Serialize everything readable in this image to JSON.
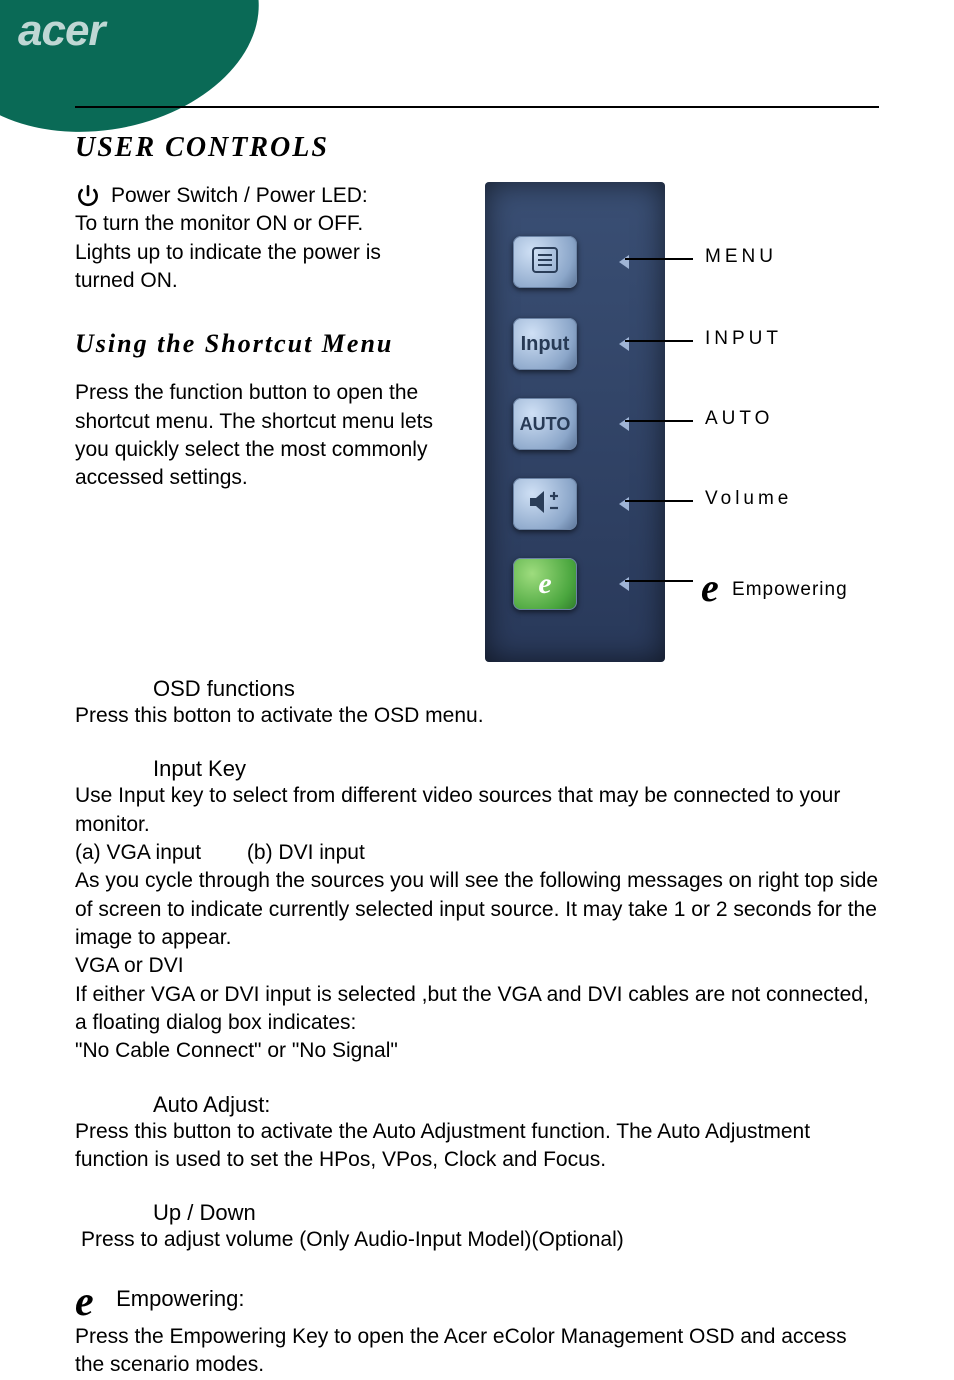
{
  "brand": {
    "logo_text": "acer"
  },
  "headings": {
    "user_controls": "USER CONTROLS",
    "shortcut_menu": "Using the Shortcut Menu"
  },
  "power": {
    "title": "Power Switch / Power LED:",
    "line1": "To turn the monitor ON or OFF.",
    "line2": "Lights up to indicate the power is turned ON."
  },
  "shortcut_intro": "Press the function button to open the shortcut menu. The shortcut menu lets you quickly select the most commonly accessed settings.",
  "callouts": {
    "menu": "MENU",
    "input": "INPUT",
    "auto": "AUTO",
    "volume": "Volume",
    "empowering_glyph": "e",
    "empowering_label": "Empowering"
  },
  "osd_buttons": {
    "menu_icon_name": "menu-lines-icon",
    "input_text": "Input",
    "auto_text": "AUTO",
    "volume_icon_name": "volume-pm-icon",
    "empower_text": "e"
  },
  "sections": {
    "osd_functions": {
      "title": "OSD functions",
      "body": "Press this botton to activate the OSD menu."
    },
    "input_key": {
      "title": "Input Key",
      "body1": "Use Input key to select from different video sources that may be connected to your monitor.",
      "opt_a": "(a) VGA input",
      "opt_b": "(b) DVI input",
      "body2": "As you cycle through the sources you will see the following messages on right top side of screen to indicate currently selected input source. It may take 1 or 2 seconds for the image to appear.",
      "body3": "VGA  or  DVI",
      "body4": "If either VGA or DVI input is selected ,but the VGA and DVI cables are not connected, a floating dialog box indicates:",
      "body5": "\"No Cable Connect\" or \"No Signal\""
    },
    "auto_adjust": {
      "title": "Auto Adjust:",
      "body": "Press this button to activate the Auto Adjustment function. The Auto Adjustment function is used to set the HPos, VPos, Clock and Focus."
    },
    "up_down": {
      "title": "Up / Down",
      "body": "Press to adjust volume (Only Audio-Input Model)(Optional)"
    },
    "empowering": {
      "glyph": "e",
      "title": "Empowering:",
      "body": "Press the Empowering Key to open the Acer eColor Management OSD and access the scenario modes."
    }
  }
}
